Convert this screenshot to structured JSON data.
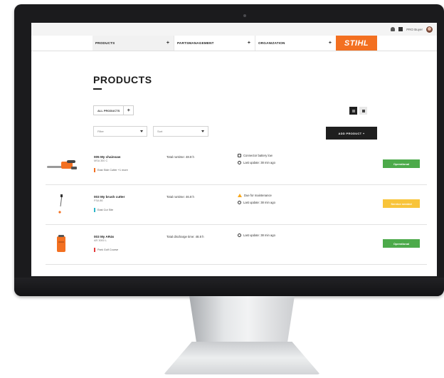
{
  "colors": {
    "brand_orange": "#f37021",
    "status_green": "#4caa4a",
    "status_yellow": "#f8c43a",
    "dark_button": "#1f1f1f"
  },
  "topbar": {
    "username": "PRO Buyer"
  },
  "navigation": {
    "items": [
      {
        "label": "PRODUCTS"
      },
      {
        "label": "PARTSMANAGEMENT"
      },
      {
        "label": "ORGANIZATION"
      }
    ],
    "logo": "STIHL"
  },
  "page": {
    "title": "PRODUCTS"
  },
  "tabs": [
    {
      "label": "ALL PRODUCTS"
    }
  ],
  "filters": {
    "filter_label": "Filter",
    "sort_label": "Sort"
  },
  "add_button": {
    "label": "ADD PRODUCT +"
  },
  "products": [
    {
      "name": "005 My chainsaw",
      "serial": "MSA 300 C",
      "tag": "East Side Cutter   +1 more",
      "tag_color": "#f37021",
      "stat": "Total runtime: 48.8 h",
      "info": [
        {
          "icon": "battery-icon",
          "text": "Connector battery low"
        },
        {
          "icon": "sync-icon",
          "text": "Last update: 38 min ago"
        }
      ],
      "status": "Operational",
      "status_color": "#4caa4a"
    },
    {
      "name": "003 My brush cutter",
      "serial": "FSA 86",
      "tag": "East Cut Site",
      "tag_color": "#2bb5c9",
      "stat": "Total runtime: 46.8 h",
      "info": [
        {
          "icon": "warning-icon",
          "text": "Due for maintenance"
        },
        {
          "icon": "sync-icon",
          "text": "Last update: 38 min ago"
        }
      ],
      "status": "Service needed",
      "status_color": "#f8c43a"
    },
    {
      "name": "003 My AR4s",
      "serial": "AR 3000 L",
      "tag": "Park Golf Course",
      "tag_color": "#e43a3a",
      "stat": "Total discharge time: 48.8 h",
      "info": [
        {
          "icon": "sync-icon",
          "text": "Last update: 38 min ago"
        }
      ],
      "status": "Operational",
      "status_color": "#4caa4a"
    }
  ]
}
